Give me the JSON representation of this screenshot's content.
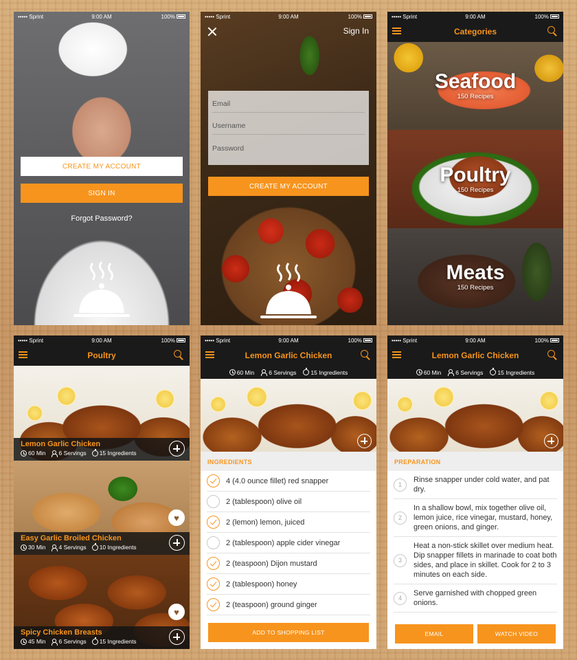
{
  "status": {
    "carrier": "••••• Sprint",
    "time": "9:00 AM",
    "battery": "100%"
  },
  "welcome": {
    "create_account": "CREATE MY ACCOUNT",
    "sign_in": "SIGN IN",
    "forgot": "Forgot Password?"
  },
  "signin": {
    "title": "Sign In",
    "email_placeholder": "Email",
    "username_placeholder": "Username",
    "password_placeholder": "Password",
    "create_account": "CREATE MY ACCOUNT"
  },
  "categories": {
    "title": "Categories",
    "items": [
      {
        "name": "Seafood",
        "count": "150 Recipes"
      },
      {
        "name": "Poultry",
        "count": "150 Recipes"
      },
      {
        "name": "Meats",
        "count": "150 Recipes"
      }
    ]
  },
  "poultry": {
    "title": "Poultry",
    "recipes": [
      {
        "title": "Lemon Garlic Chicken",
        "time": "60 Min",
        "servings": "6 Servings",
        "ingredients": "15 Ingredients"
      },
      {
        "title": "Easy Garlic Broiled Chicken",
        "time": "30 Min",
        "servings": "4 Servings",
        "ingredients": "10 Ingredients"
      },
      {
        "title": "Spicy Chicken Breasts",
        "time": "45 Min",
        "servings": "6 Servings",
        "ingredients": "15 Ingredients"
      }
    ]
  },
  "detail": {
    "title": "Lemon Garlic Chicken",
    "time": "60 Min",
    "servings": "6 Servings",
    "ingredients_count": "15 Ingredients",
    "ingredients_head": "INGREDIENTS",
    "ingredients": [
      {
        "text": "4 (4.0 ounce fillet) red snapper",
        "checked": true
      },
      {
        "text": "2 (tablespoon) olive oil",
        "checked": false
      },
      {
        "text": "2 (lemon) lemon, juiced",
        "checked": true
      },
      {
        "text": "2 (tablespoon) apple cider vinegar",
        "checked": false
      },
      {
        "text": "2 (teaspoon) Dijon mustard",
        "checked": true
      },
      {
        "text": "2 (tablespoon) honey",
        "checked": true
      },
      {
        "text": "2 (teaspoon) ground ginger",
        "checked": true
      }
    ],
    "add_to_list": "ADD TO SHOPPING LIST",
    "preparation_head": "PREPARATION",
    "steps": [
      {
        "num": "1",
        "text": "Rinse snapper under cold water, and pat dry."
      },
      {
        "num": "2",
        "text": "In a shallow bowl, mix together olive oil, lemon juice, rice vinegar, mustard, honey, green onions, and ginger."
      },
      {
        "num": "3",
        "text": "Heat a non-stick skillet over medium heat. Dip snapper fillets in marinade to coat both sides, and place in skillet. Cook for 2 to 3 minutes on each side."
      },
      {
        "num": "4",
        "text": "Serve garnished with chopped green onions."
      }
    ],
    "email": "EMAIL",
    "watch_video": "WATCH VIDEO"
  },
  "colors": {
    "accent": "#f7941d",
    "dark": "#1a1a1a"
  }
}
